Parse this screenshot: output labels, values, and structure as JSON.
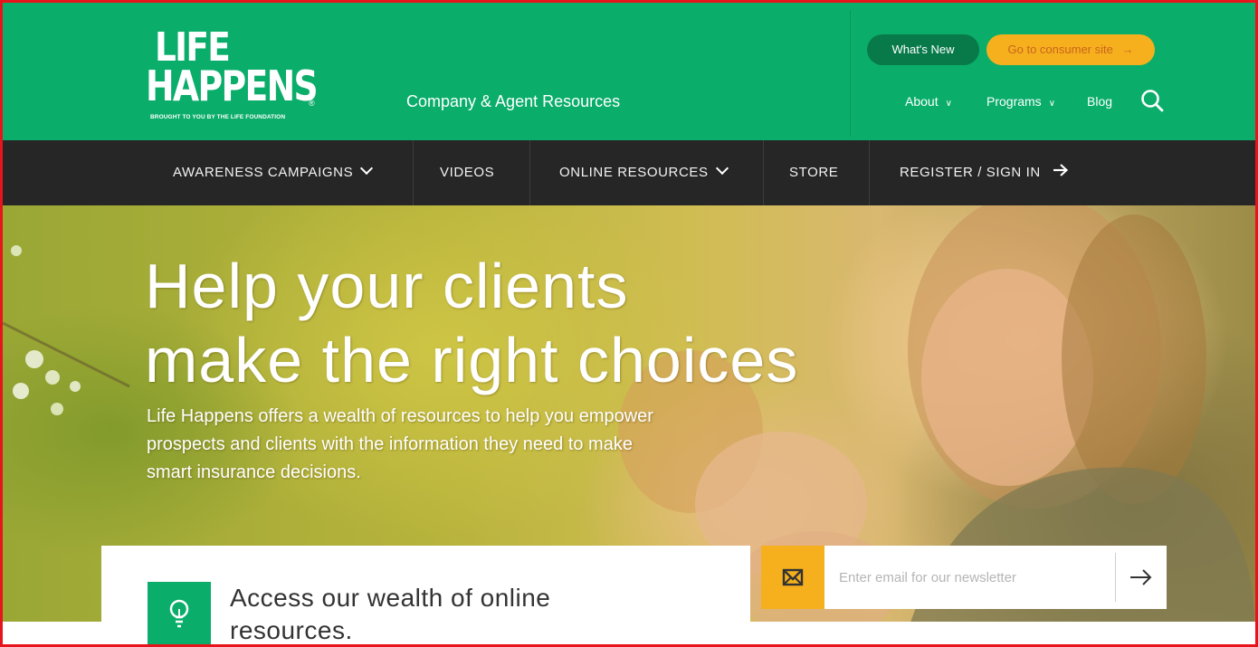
{
  "brand": {
    "logo_line1": "LIFE",
    "logo_line2": "HAPPENS",
    "logo_registered": "®",
    "logo_tagline": "BROUGHT TO YOU BY THE LIFE FOUNDATION",
    "section_title": "Company & Agent Resources",
    "primary_color": "#0aad6a",
    "accent_color": "#f6b01d",
    "nav_bg": "#262626"
  },
  "header": {
    "whats_new": "What's New",
    "consumer_site": "Go to consumer site",
    "util_nav": [
      {
        "label": "About",
        "icon": "chevron-down-icon"
      },
      {
        "label": "Programs",
        "icon": "chevron-down-icon"
      },
      {
        "label": "Blog"
      }
    ],
    "search_icon": "search-icon"
  },
  "main_nav": [
    {
      "label": "AWARENESS CAMPAIGNS",
      "icon": "chevron-down-icon"
    },
    {
      "label": "VIDEOS"
    },
    {
      "label": "ONLINE RESOURCES",
      "icon": "chevron-down-icon"
    },
    {
      "label": "STORE"
    },
    {
      "label": "REGISTER / SIGN IN",
      "icon": "arrow-right-icon"
    }
  ],
  "hero": {
    "title_line1": "Help your clients",
    "title_line2": "make the right choices",
    "description": "Life Happens offers a wealth of resources to help you empower prospects and clients with the information they need to make smart insurance decisions."
  },
  "resources_card": {
    "icon": "lightbulb-icon",
    "text": "Access our wealth of online resources."
  },
  "newsletter": {
    "icon": "envelope-icon",
    "placeholder": "Enter email for our newsletter",
    "value": "",
    "submit_icon": "arrow-right-icon"
  }
}
